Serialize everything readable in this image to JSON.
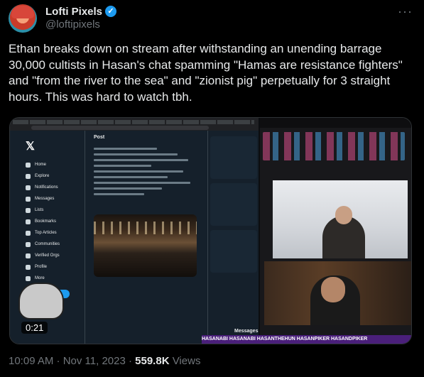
{
  "author": {
    "display_name": "Lofti Pixels",
    "handle": "@loftipixels",
    "avatar_icon": "avatar-icon",
    "verified_icon": "verified-badge-icon"
  },
  "tweet": {
    "text": "Ethan breaks down on stream after withstanding an unending barrage 30,000 cultists in Hasan's chat spamming \"Hamas are resistance fighters\" and \"from the river to the sea\" and \"zionist pig\" perpetually for 3 straight hours. This was hard to watch tbh."
  },
  "media": {
    "timestamp": "0:21",
    "x_sidebar": [
      "Home",
      "Explore",
      "Notifications",
      "Messages",
      "Lists",
      "Bookmarks",
      "Top Articles",
      "Communities",
      "Verified Orgs",
      "Profile",
      "More"
    ],
    "x_post_button": "Post",
    "x_main_title": "Post",
    "messages_label": "Messages",
    "banner_text": "HASANABI HASANABI HASANTHEHUN HASANPIKER HASANDPIKER"
  },
  "meta": {
    "time": "10:09 AM · Nov 11, 2023 · ",
    "views_count": "559.8K",
    "views_label": "Views"
  }
}
